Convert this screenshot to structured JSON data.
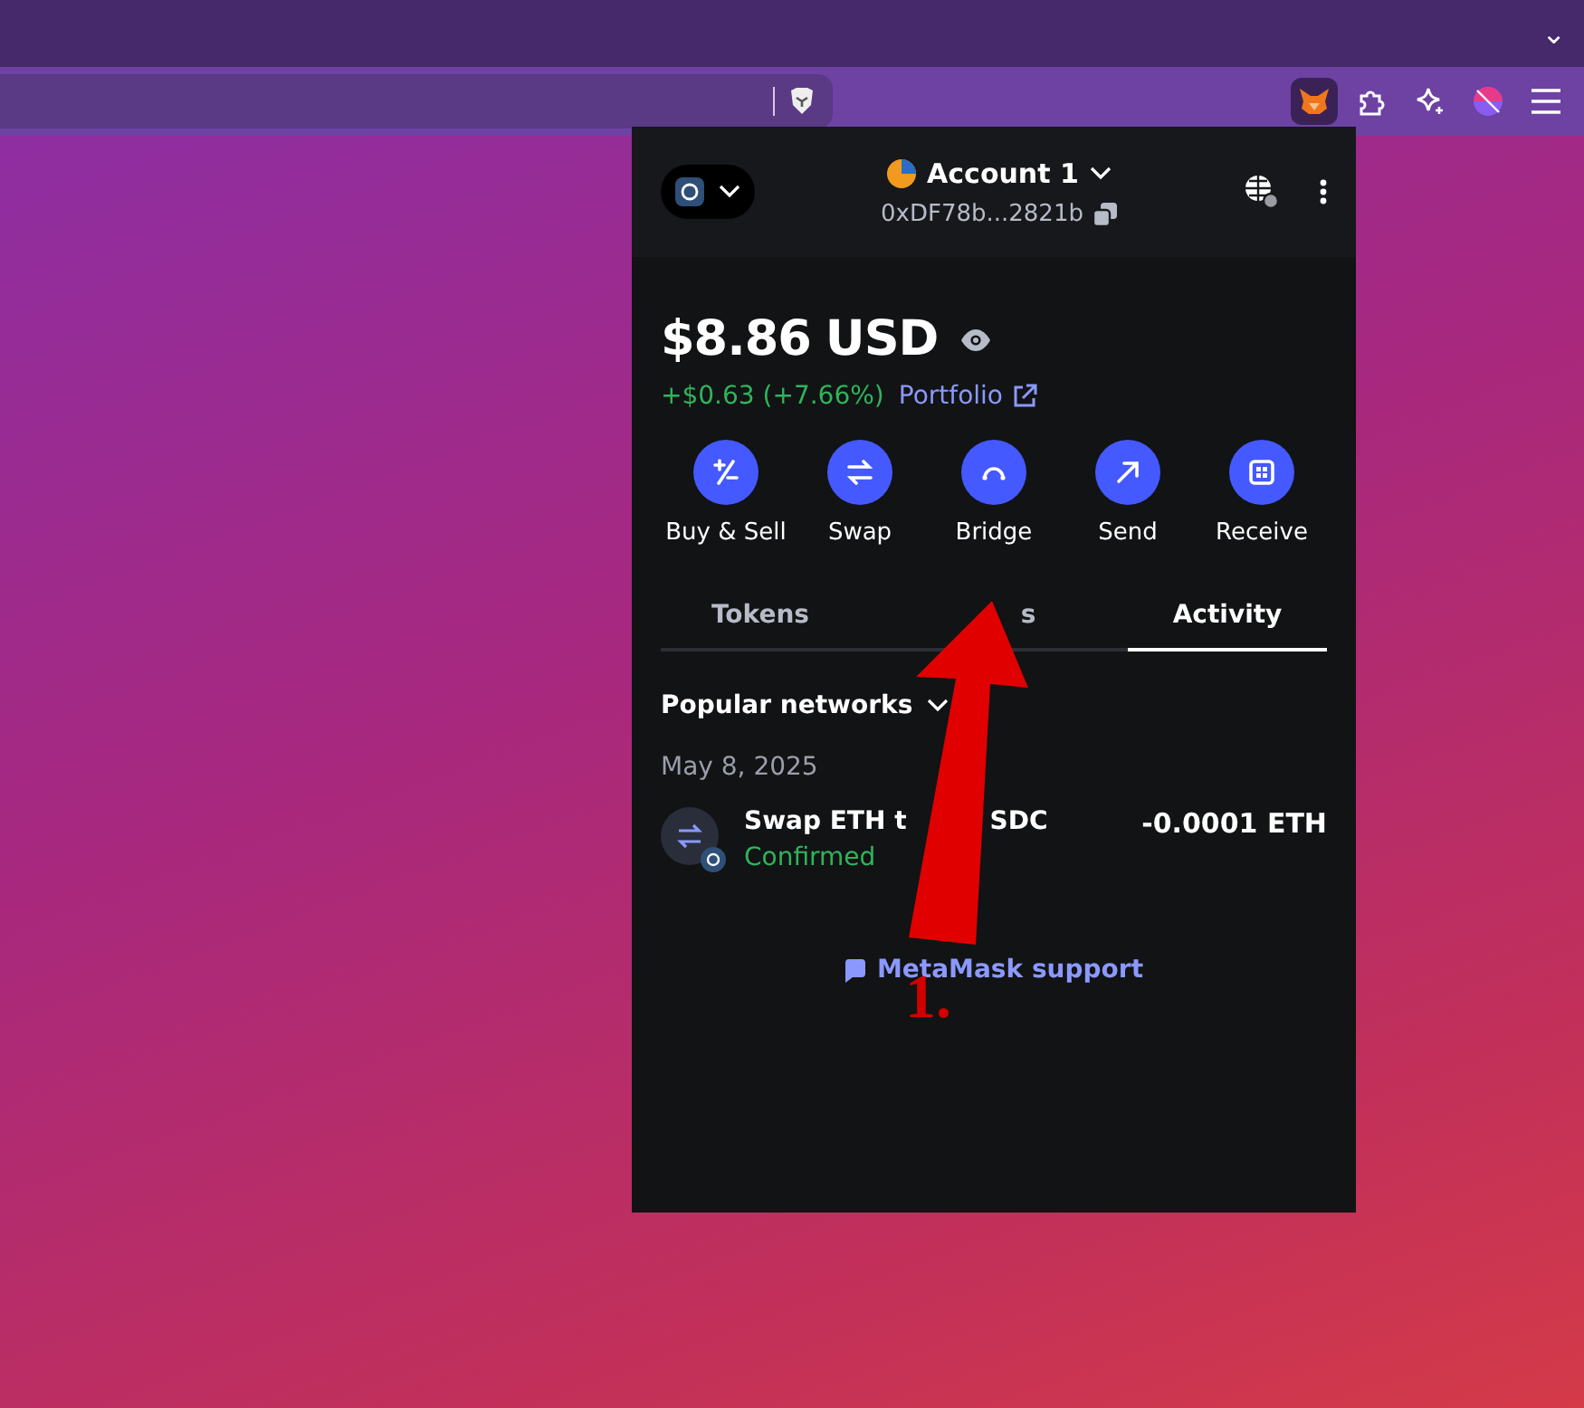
{
  "browser": {
    "menu_caret": "⌄"
  },
  "popup": {
    "account": {
      "name": "Account 1",
      "address": "0xDF78b...2821b"
    },
    "balance": {
      "amount": "$8.86",
      "currency": "USD",
      "change": "+$0.63 (+7.66%)",
      "portfolio_link": "Portfolio"
    },
    "actions": [
      {
        "kind": "buysell",
        "label": "Buy & Sell"
      },
      {
        "kind": "swap",
        "label": "Swap"
      },
      {
        "kind": "bridge",
        "label": "Bridge"
      },
      {
        "kind": "send",
        "label": "Send"
      },
      {
        "kind": "receive",
        "label": "Receive"
      }
    ],
    "tabs": [
      {
        "label": "Tokens",
        "selected": false
      },
      {
        "label": "s",
        "selected": false
      },
      {
        "label": "Activity",
        "selected": true
      }
    ],
    "network_filter": "Popular networks",
    "date": "May 8, 2025",
    "transactions": [
      {
        "title": "Swap ETH t",
        "title_end": "SDC",
        "status": "Confirmed",
        "amount": "-0.0001 ETH"
      }
    ],
    "support_link": "MetaMask support"
  },
  "annotation": {
    "label": "1."
  }
}
